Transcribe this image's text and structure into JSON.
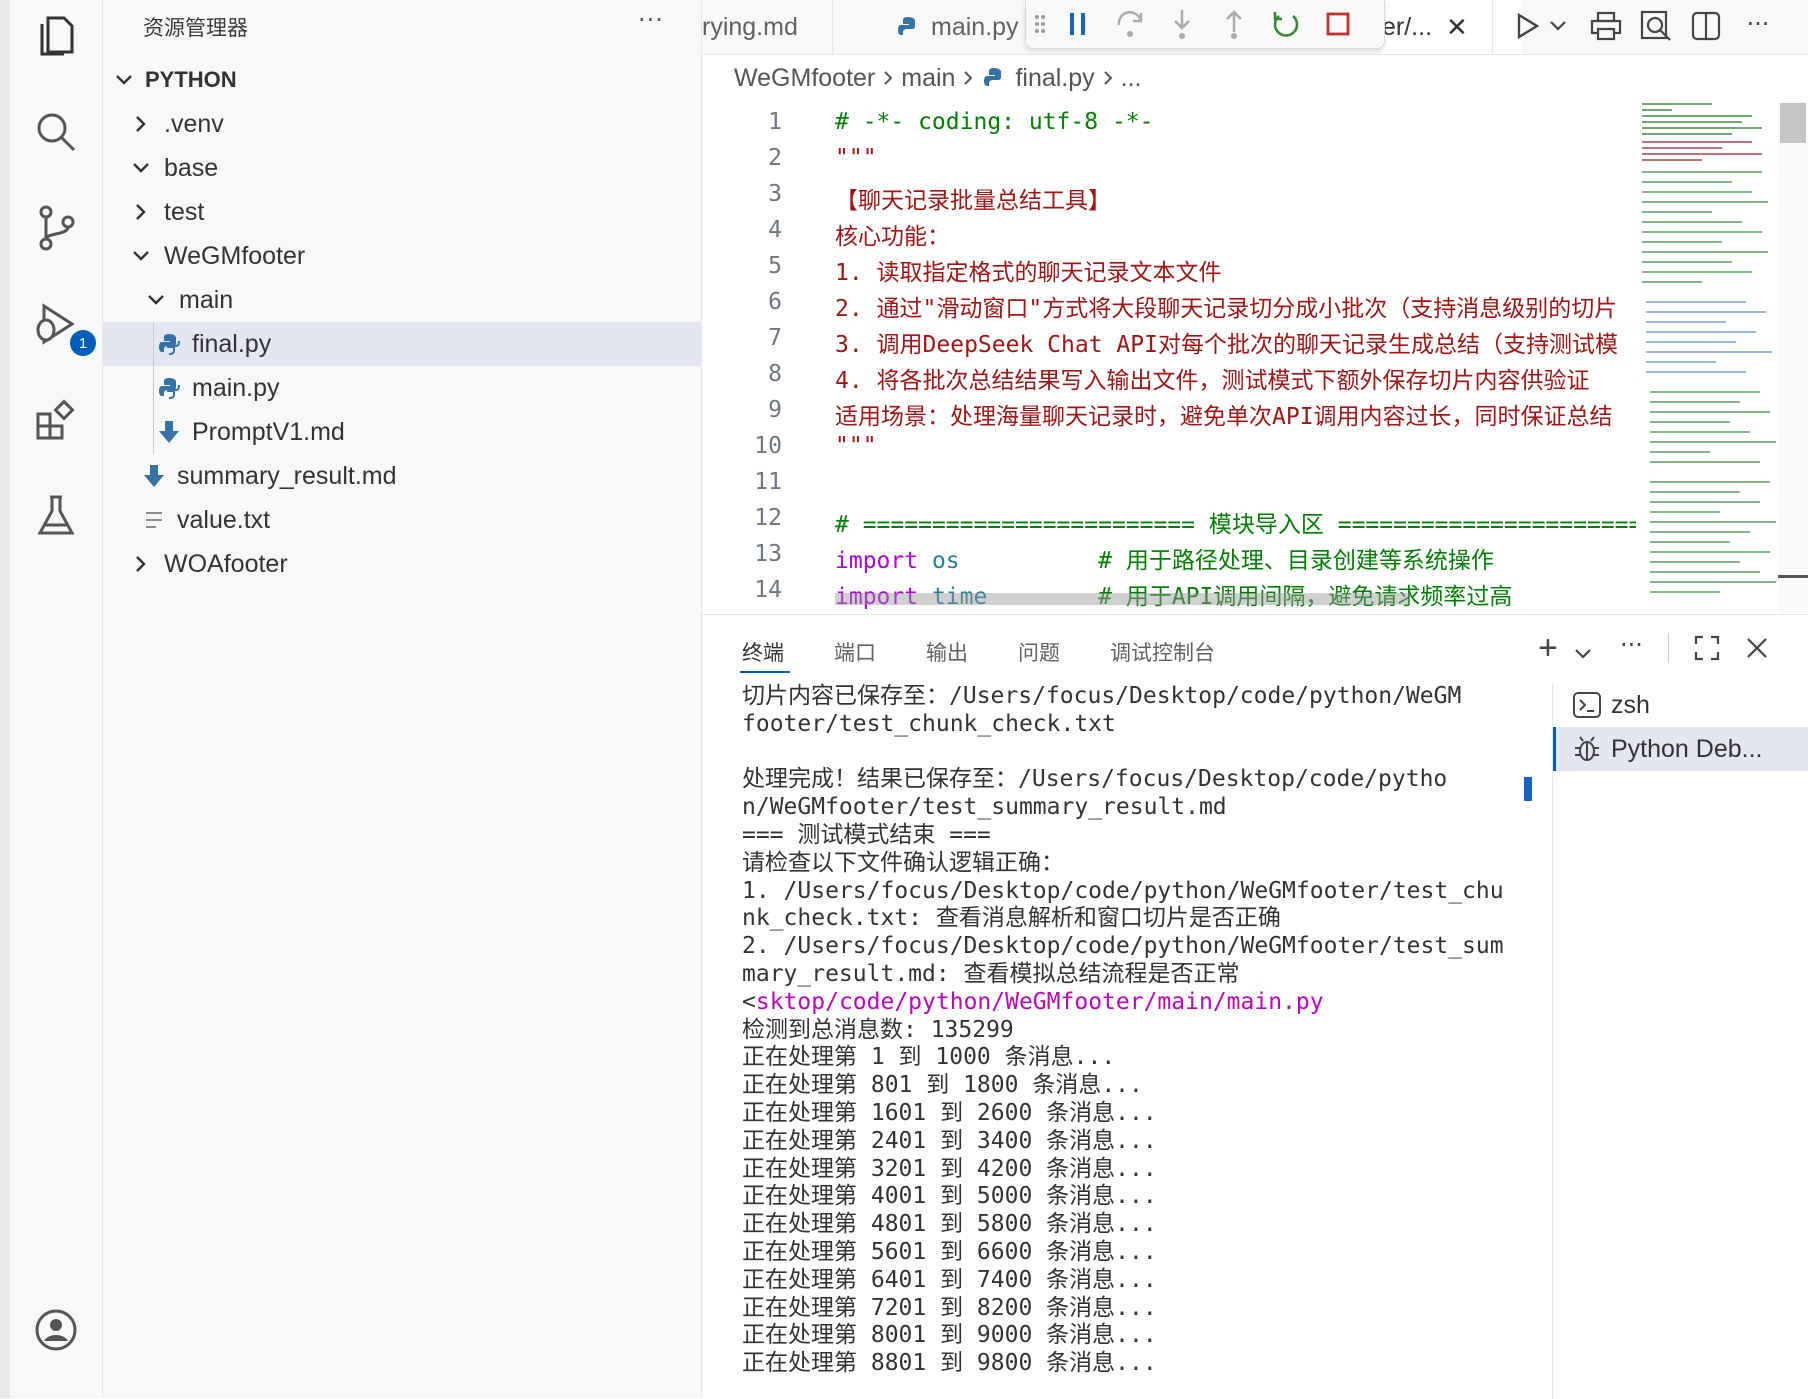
{
  "activity_bar": {
    "items": [
      {
        "name": "explorer-icon"
      },
      {
        "name": "search-icon"
      },
      {
        "name": "source-control-icon"
      },
      {
        "name": "run-debug-icon",
        "badge": "1"
      },
      {
        "name": "extensions-icon"
      },
      {
        "name": "testing-icon"
      }
    ],
    "account_icon": "account-icon"
  },
  "sidebar": {
    "title": "资源管理器",
    "more": "···",
    "root": "PYTHON",
    "tree": [
      {
        "label": ".venv",
        "type": "folder",
        "expanded": false
      },
      {
        "label": "base",
        "type": "folder",
        "expanded": true
      },
      {
        "label": "test",
        "type": "folder",
        "expanded": false
      },
      {
        "label": "WeGMfooter",
        "type": "folder",
        "expanded": true
      },
      {
        "label": "main",
        "type": "folder",
        "expanded": true
      },
      {
        "label": "final.py",
        "type": "python",
        "selected": true
      },
      {
        "label": "main.py",
        "type": "python"
      },
      {
        "label": "PromptV1.md",
        "type": "markdown"
      },
      {
        "label": "summary_result.md",
        "type": "markdown"
      },
      {
        "label": "value.txt",
        "type": "text"
      },
      {
        "label": "WOAfooter",
        "type": "folder",
        "expanded": false
      }
    ]
  },
  "tabs": {
    "items": [
      {
        "label": "rying.md"
      },
      {
        "label": "main.py"
      },
      {
        "label": "er/..."
      }
    ],
    "close": "✕"
  },
  "breadcrumb": {
    "parts": [
      "WeGMfooter",
      "main",
      "final.py",
      "..."
    ]
  },
  "editor": {
    "lines": [
      {
        "n": "1",
        "t": "# -*- coding: utf-8 -*-"
      },
      {
        "n": "2",
        "t": "\"\"\""
      },
      {
        "n": "3",
        "t": "【聊天记录批量总结工具】"
      },
      {
        "n": "4",
        "t": "核心功能："
      },
      {
        "n": "5",
        "t": "1. 读取指定格式的聊天记录文本文件"
      },
      {
        "n": "6",
        "t": "2. 通过\"滑动窗口\"方式将大段聊天记录切分成小批次（支持消息级别的切片"
      },
      {
        "n": "7",
        "t": "3. 调用DeepSeek Chat API对每个批次的聊天记录生成总结（支持测试模"
      },
      {
        "n": "8",
        "t": "4. 将各批次总结结果写入输出文件，测试模式下额外保存切片内容供验证"
      },
      {
        "n": "9",
        "t": "适用场景：处理海量聊天记录时，避免单次API调用内容过长，同时保证总结"
      },
      {
        "n": "10",
        "t": "\"\"\""
      },
      {
        "n": "11",
        "t": ""
      },
      {
        "n": "12",
        "t": "# ======================== 模块导入区 ======================"
      },
      {
        "n": "13",
        "kw": "import",
        "mod": "os",
        "comment": "# 用于路径处理、目录创建等系统操作"
      },
      {
        "n": "14",
        "kw": "import",
        "mod": "time",
        "comment": "# 用于API调用间隔，避免请求频率过高"
      }
    ]
  },
  "panel": {
    "tabs": [
      "终端",
      "端口",
      "输出",
      "问题",
      "调试控制台"
    ],
    "active_tab": "终端",
    "terminal_lines": [
      "切片内容已保存至：/Users/focus/Desktop/code/python/WeGM",
      "footer/test_chunk_check.txt",
      "",
      "处理完成！结果已保存至：/Users/focus/Desktop/code/pytho",
      "n/WeGMfooter/test_summary_result.md",
      "=== 测试模式结束 ===",
      "请检查以下文件确认逻辑正确：",
      "1. /Users/focus/Desktop/code/python/WeGMfooter/test_chu",
      "nk_check.txt: 查看消息解析和窗口切片是否正确",
      "2. /Users/focus/Desktop/code/python/WeGMfooter/test_sum",
      "mary_result.md: 查看模拟总结流程是否正常"
    ],
    "terminal_prompt_prefix": "<",
    "terminal_link": "sktop/code/python/WeGMfooter/main/main.py",
    "terminal_lines_after": [
      "检测到总消息数: 135299",
      "正在处理第 1 到 1000 条消息...",
      "正在处理第 801 到 1800 条消息...",
      "正在处理第 1601 到 2600 条消息...",
      "正在处理第 2401 到 3400 条消息...",
      "正在处理第 3201 到 4200 条消息...",
      "正在处理第 4001 到 5000 条消息...",
      "正在处理第 4801 到 5800 条消息...",
      "正在处理第 5601 到 6600 条消息...",
      "正在处理第 6401 到 7400 条消息...",
      "正在处理第 7201 到 8200 条消息...",
      "正在处理第 8001 到 9000 条消息...",
      "正在处理第 8801 到 9800 条消息..."
    ],
    "terminals": [
      {
        "label": "zsh",
        "icon": "terminal-icon"
      },
      {
        "label": "Python Deb...",
        "icon": "debug-icon",
        "active": true
      }
    ],
    "more": "···",
    "add": "+"
  },
  "colors": {
    "accent": "#005fb8",
    "comment": "#008000",
    "string": "#a31515",
    "keyword": "#af00db",
    "link": "#bc05bc"
  }
}
